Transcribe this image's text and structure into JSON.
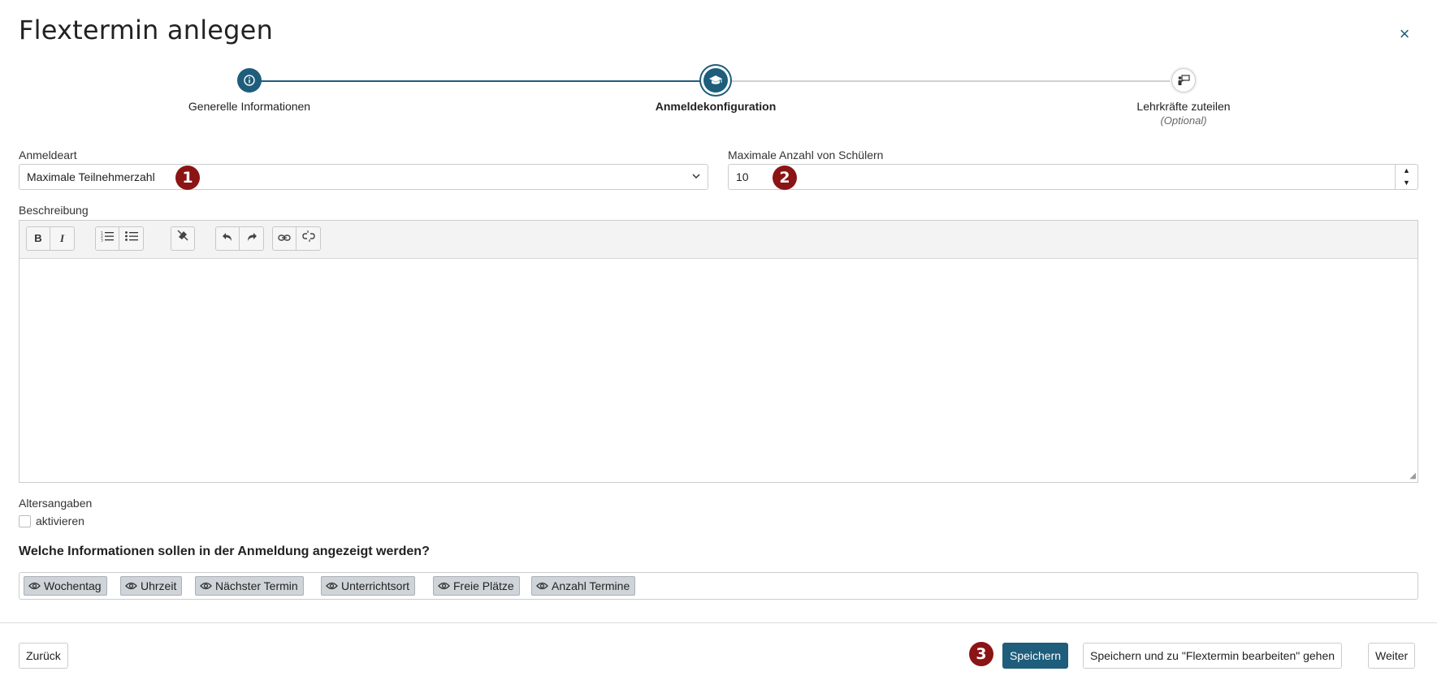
{
  "title": "Flextermin anlegen",
  "close_icon_label": "×",
  "steps": [
    {
      "label": "Generelle Informationen",
      "icon": "info-icon"
    },
    {
      "label": "Anmeldekonfiguration",
      "icon": "graduation-cap-icon"
    },
    {
      "label": "Lehrkräfte zuteilen",
      "sub": "(Optional)",
      "icon": "teacher-icon"
    }
  ],
  "registration_type": {
    "label": "Anmeldeart",
    "value": "Maximale Teilnehmerzahl"
  },
  "max_students": {
    "label": "Maximale Anzahl von Schülern",
    "value": "10"
  },
  "description": {
    "label": "Beschreibung"
  },
  "toolbar": {
    "bold": "B",
    "italic": "I",
    "icons": [
      "ordered-list-icon",
      "unordered-list-icon",
      "clear-format-icon",
      "undo-icon",
      "redo-icon",
      "link-icon",
      "unlink-icon"
    ]
  },
  "age": {
    "label": "Altersangaben",
    "checkbox_label": "aktivieren"
  },
  "info_heading": "Welche Informationen sollen in der Anmeldung angezeigt werden?",
  "tags": [
    "Wochentag",
    "Uhrzeit",
    "Nächster Termin",
    "Unterrichtsort",
    "Freie Plätze",
    "Anzahl Termine"
  ],
  "badges": [
    "1",
    "2",
    "3"
  ],
  "buttons": {
    "back": "Zurück",
    "save": "Speichern",
    "save_edit": "Speichern und zu \"Flextermin bearbeiten\" gehen",
    "next": "Weiter"
  },
  "colors": {
    "primary": "#1e5d7b",
    "badge": "#8b1414"
  }
}
